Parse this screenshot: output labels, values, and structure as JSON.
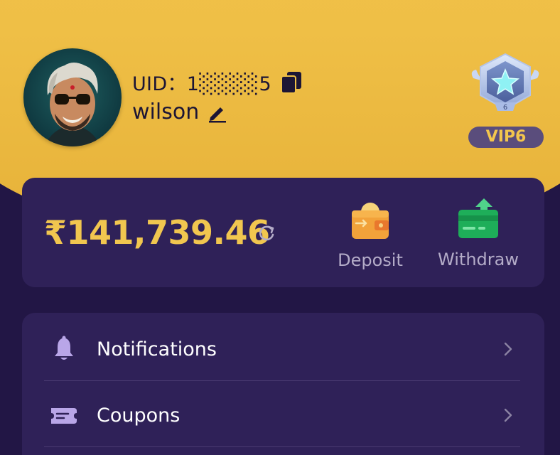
{
  "profile": {
    "uid_label": "UID：",
    "uid_value": "1░░░░5",
    "username": "wilson",
    "vip_level": "VIP6",
    "badge_number": "6"
  },
  "wallet": {
    "balance": "₹141,739.46",
    "deposit_label": "Deposit",
    "withdraw_label": "Withdraw"
  },
  "menu": {
    "items": [
      {
        "label": "Notifications",
        "icon": "bell-icon"
      },
      {
        "label": "Coupons",
        "icon": "ticket-icon"
      }
    ]
  },
  "colors": {
    "header": "#f4c34f",
    "background": "#221645",
    "card": "#2f2158",
    "accent": "#f1c64f",
    "muted_text": "#b4acc8"
  }
}
